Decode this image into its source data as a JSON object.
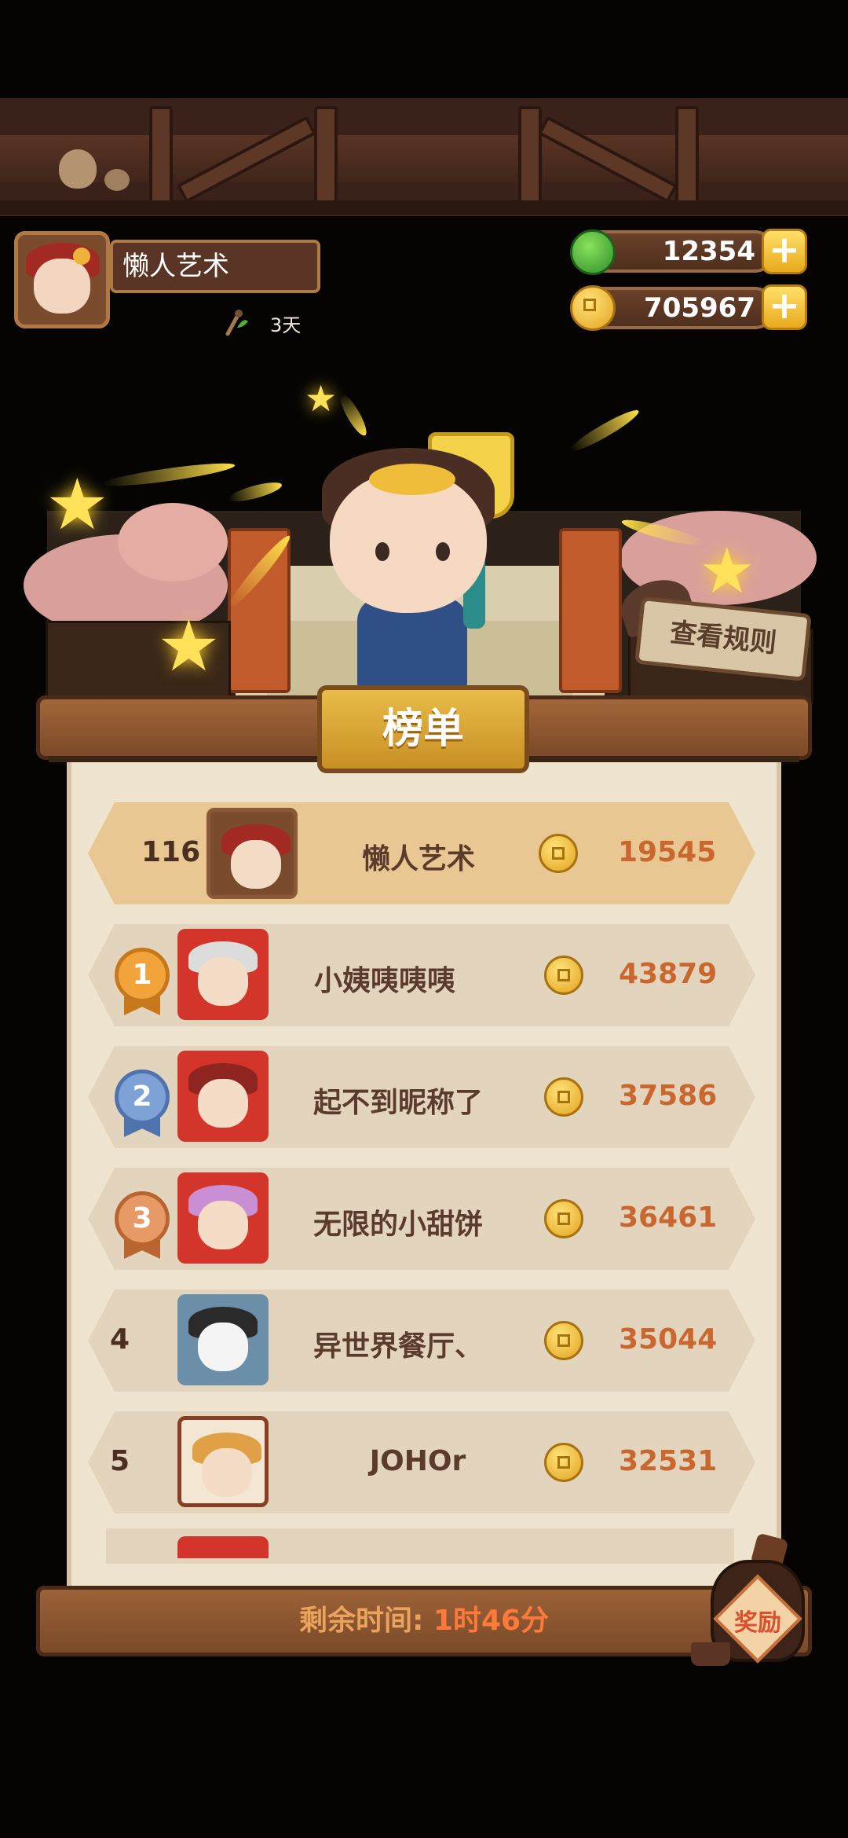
{
  "player": {
    "name": "懒人艺术",
    "status_days": "3天"
  },
  "currency": {
    "jade": "12354",
    "coins": "705967"
  },
  "stage": {
    "rules_button": "查看规则"
  },
  "leaderboard": {
    "title": "榜单",
    "me": {
      "rank": "116",
      "name": "懒人艺术",
      "score": "19545"
    },
    "rows": [
      {
        "rank": "1",
        "name": "小姨咦咦咦",
        "score": "43879",
        "medal": "gold"
      },
      {
        "rank": "2",
        "name": "起不到昵称了",
        "score": "37586",
        "medal": "silver"
      },
      {
        "rank": "3",
        "name": "无限的小甜饼",
        "score": "36461",
        "medal": "bronze"
      },
      {
        "rank": "4",
        "name": "异世界餐厅、",
        "score": "35044"
      },
      {
        "rank": "5",
        "name": "JOHOr",
        "score": "32531"
      }
    ]
  },
  "footer": {
    "timer_label": "剩余时间: ",
    "timer_value": "1时46分",
    "reward_button": "奖励"
  },
  "colors": {
    "background": "#050403",
    "wood": "#7b4a28",
    "parchment": "#efe4cf",
    "row": "#e3d4bd",
    "row_me": "#e8c792",
    "score": "#c9672e",
    "gold": "#f2a43a",
    "silver": "#7fa2d6",
    "bronze": "#e89a66"
  }
}
